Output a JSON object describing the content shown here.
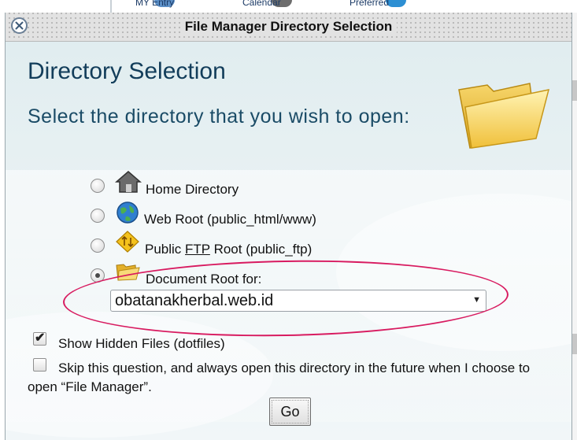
{
  "dialog": {
    "title": "File Manager Directory Selection",
    "heading": "Directory Selection",
    "prompt": "Select the directory that you wish to open:"
  },
  "options": [
    {
      "label": "Home Directory",
      "icon": "home-icon",
      "selected": false
    },
    {
      "label": "Web Root (public_html/www)",
      "icon": "globe-icon",
      "selected": false
    },
    {
      "label_before": "Public ",
      "label_abbr": "FTP",
      "label_after": " Root (public_ftp)",
      "icon": "ftp-icon",
      "selected": false
    },
    {
      "label": "Document Root for:",
      "icon": "folder-icon",
      "selected": true
    }
  ],
  "document_root_select": {
    "value": "obatanakherbal.web.id"
  },
  "show_hidden": {
    "label": "Show Hidden Files (dotfiles)",
    "checked": true
  },
  "skip_question": {
    "label": "Skip this question, and always open this directory in the future when I choose to open “File Manager”.",
    "checked": false
  },
  "go_button": {
    "label": "Go"
  },
  "background": {
    "items": [
      "MY Entry",
      "Calendar",
      "Preferred"
    ]
  },
  "colors": {
    "heading": "#123d5a",
    "annotation_ring": "#d81b60",
    "dialog_bg": "#e3eef1"
  }
}
